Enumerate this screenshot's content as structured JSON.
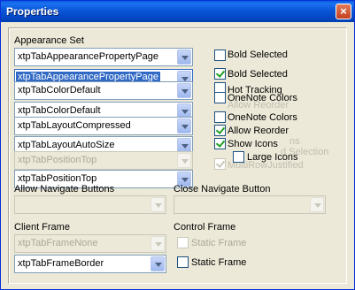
{
  "window": {
    "title": "Properties",
    "close_glyph": "×"
  },
  "appearance": {
    "label": "Appearance Set",
    "combos": [
      "xtpTabAppearancePropertyPage",
      "xtpTabAppearancePropertyPage",
      "xtpTabColorDefault",
      "xtpTabColorDefault",
      "xtpTabLayoutCompressed",
      "xtpTabLayoutAutoSize",
      "xtpTabPositionTop",
      "xtpTabPositionTop"
    ]
  },
  "checkboxes": {
    "bold_selected": "Bold Selected",
    "bold_selected_2": "Bold Selected",
    "hot_tracking": "Hot Tracking",
    "onenote_colors": "OneNote Colors",
    "onenote_colors_2": "OneNote Colors",
    "allow_reorder": "Allow Reorder",
    "show_icons": "Show Icons",
    "large_icons": "Large Icons",
    "ghost_allow_reorder": "Allow Reorder",
    "ghost_ns": "ns",
    "ghost_selection": "d Selection",
    "ghost_justified": "MultiRowJustified"
  },
  "navigate": {
    "allow_label": "Allow Navigate Buttons",
    "close_label": "Close Navigate Button"
  },
  "client_frame": {
    "label": "Client Frame",
    "combo_disabled": "xtpTabFrameNone",
    "combo_enabled": "xtpTabFrameBorder"
  },
  "control_frame": {
    "label": "Control Frame",
    "static_frame_disabled": "Static Frame",
    "static_frame": "Static Frame"
  },
  "colors": {
    "titlebar": "#0a56d8",
    "background": "#ece9d8",
    "highlight": "#316ac5",
    "check": "#21a121"
  },
  "icons": {
    "close": "close-icon",
    "dropdown": "chevron-down-icon"
  }
}
